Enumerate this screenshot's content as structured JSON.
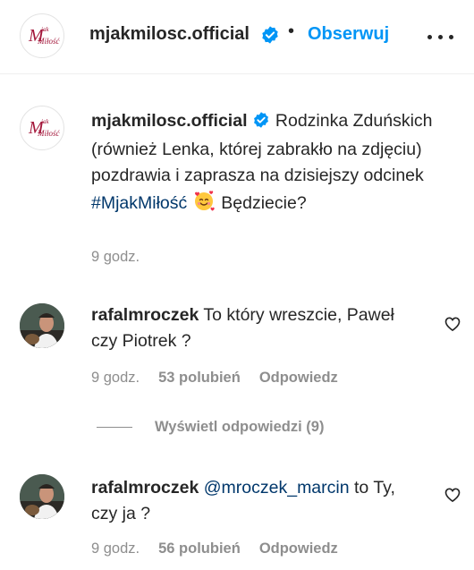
{
  "header": {
    "username": "mjakmilosc.official",
    "separator": "•",
    "follow_label": "Obserwuj"
  },
  "brand_logo": {
    "line1": "M",
    "line2": "jak",
    "line3": "Miłość",
    "color": "#a3163a"
  },
  "caption": {
    "username": "mjakmilosc.official",
    "text_before": "Rodzinka Zduńskich (również Lenka, której zabrakło na zdjęciu) pozdrawia i zaprasza na dzisiejszy odcinek",
    "hashtag": "#MjakMiłość",
    "text_after": "Będziecie?",
    "emoji": "smiling-face-with-hearts",
    "time": "9 godz."
  },
  "comments": [
    {
      "username": "rafalmroczek",
      "mention": "",
      "text": "To który wreszcie, Paweł czy Piotrek ?",
      "time": "9 godz.",
      "likes": "53 polubień",
      "reply_label": "Odpowiedz"
    },
    {
      "username": "rafalmroczek",
      "mention": "@mroczek_marcin",
      "text": "to Ty, czy ja ?",
      "time": "9 godz.",
      "likes": "56 polubień",
      "reply_label": "Odpowiedz"
    }
  ],
  "view_replies_label": "Wyświetl odpowiedzi (9)",
  "colors": {
    "link_blue": "#0095f6",
    "hashtag": "#00376b",
    "muted": "#8e8e8e",
    "verified": "#0095f6"
  }
}
